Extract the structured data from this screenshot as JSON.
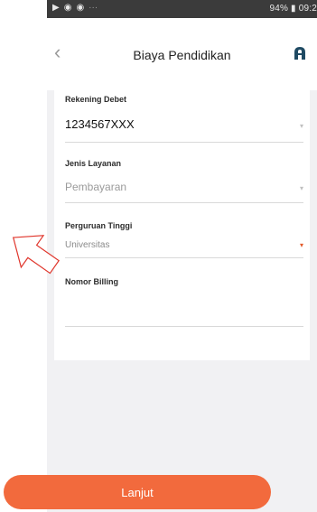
{
  "status_bar": {
    "right_text": "94% ▮ 09:2"
  },
  "header": {
    "title": "Biaya Pendidikan"
  },
  "form": {
    "rekening_debet_label": "Rekening Debet",
    "rekening_debet_value": "1234567XXX",
    "jenis_layanan_label": "Jenis Layanan",
    "jenis_layanan_value": "Pembayaran",
    "perguruan_tinggi_label": "Perguruan Tinggi",
    "perguruan_tinggi_value": "Universitas",
    "nomor_billing_label": "Nomor Billing",
    "nomor_billing_value": ""
  },
  "footer": {
    "next_label": "Lanjut"
  },
  "colors": {
    "accent": "#f26a3d",
    "status_bar_bg": "#3b3b3b",
    "background": "#f1f1f3"
  },
  "icons": {
    "back": "chevron-left-icon",
    "logo": "bank-logo-icon",
    "caret": "caret-down-icon",
    "annotation": "hollow-arrow-icon"
  }
}
